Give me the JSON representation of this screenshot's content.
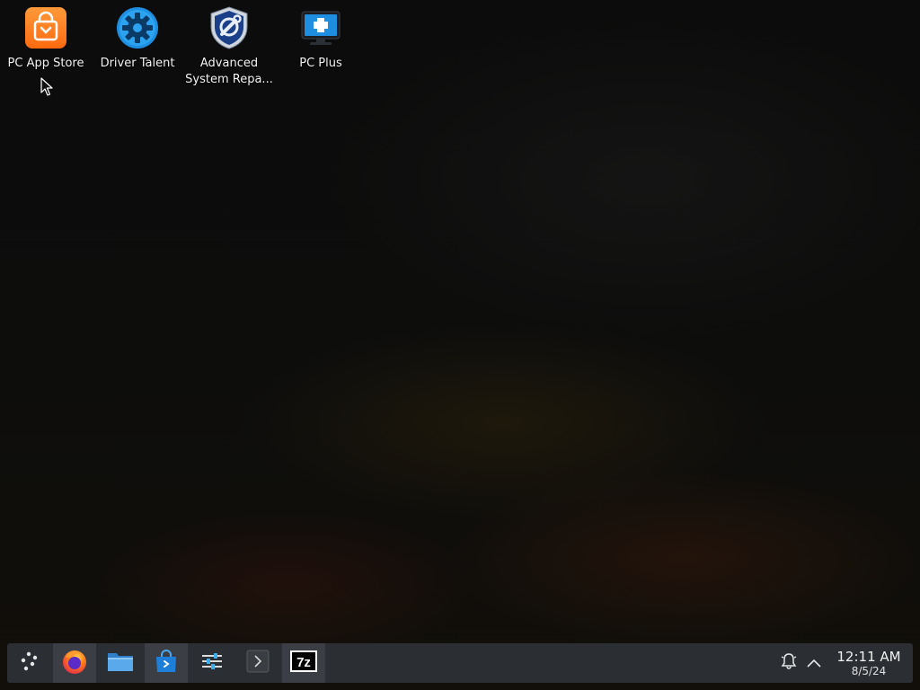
{
  "desktop": {
    "icons": [
      {
        "label": "PC App Store",
        "icon": "shopping-bag-icon"
      },
      {
        "label": "Driver Talent",
        "icon": "gear-icon"
      },
      {
        "label": "Advanced\nSystem Repa...",
        "icon": "shield-wrench-icon"
      },
      {
        "label": "PC Plus",
        "icon": "monitor-plus-icon"
      }
    ]
  },
  "taskbar": {
    "items": [
      {
        "name": "application-launcher",
        "icon": "launcher-icon"
      },
      {
        "name": "firefox",
        "icon": "firefox-icon"
      },
      {
        "name": "file-manager",
        "icon": "folder-icon"
      },
      {
        "name": "app-store",
        "icon": "store-bag-icon"
      },
      {
        "name": "system-settings",
        "icon": "sliders-icon"
      },
      {
        "name": "terminal",
        "icon": "terminal-icon"
      },
      {
        "name": "7zip",
        "icon": "7z-icon",
        "text": "7z"
      }
    ],
    "tray": {
      "notifications_icon": "bell-icon",
      "expand_icon": "chevron-up-icon",
      "time": "12:11 AM",
      "date": "8/5/24"
    }
  },
  "colors": {
    "taskbar_bg": "#2b2e33",
    "active_item_bg": "#3b3f45",
    "app_store_orange": "#ff7a1a",
    "driver_talent_blue": "#1e8fe0"
  }
}
